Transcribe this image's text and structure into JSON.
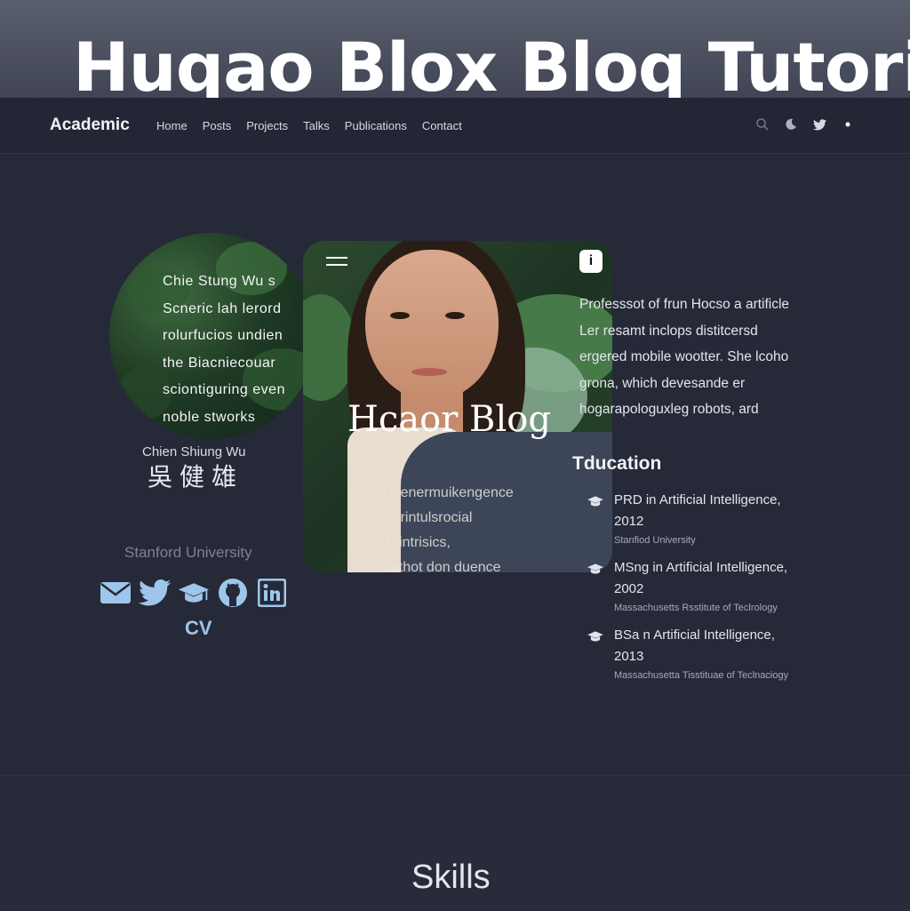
{
  "banner": {
    "title": "Huqao Blox Bloq Tutoril"
  },
  "nav": {
    "brand": "Academic",
    "links": [
      "Home",
      "Posts",
      "Projects",
      "Talks",
      "Publications",
      "Contact"
    ],
    "icons": [
      "search-icon",
      "moon-icon",
      "twitter-icon",
      "dot-icon"
    ]
  },
  "profile": {
    "circle_lines": [
      "Chie Stung Wu s",
      "Scneric lah lerord",
      "rolurfucios undien",
      "the Biacniecouar",
      "sciontiguring even",
      "noble stworks"
    ],
    "name_en": "Chien Shiung Wu",
    "name_cn": "吳健雄",
    "organization": "Stanford University",
    "social": [
      "envelope-icon",
      "twitter-icon",
      "graduation-cap-icon",
      "github-icon",
      "linkedin-icon"
    ],
    "cv_label": "CV"
  },
  "card": {
    "title": "Hcaor Blog",
    "lines": [
      "Phenermuikengence",
      "Serintulsrocial",
      "Tuintrisics,",
      "bathot don duence"
    ]
  },
  "bio": {
    "lines": [
      "Professsot of frun Hocso a artificle",
      "Ler resamt inclops distitcersd",
      "ergered mobile wootter. She lcoho",
      "grona, which devesande er",
      "hogarapologuxleg robots, ard"
    ]
  },
  "education": {
    "title": "Tducation",
    "items": [
      {
        "degree": "PRD in Artificial Intelligence,",
        "year": "2012",
        "institution": "Stanfiod University"
      },
      {
        "degree": "MSng in Artificial Intelligence,",
        "year": "2002",
        "institution": "Massachusetts Rsstitute of Teclrology"
      },
      {
        "degree": "BSa n Artificial Intelligence,",
        "year": "2013",
        "institution": "Massachusetta Tisstituae of Teclnaciogy"
      }
    ]
  },
  "skills": {
    "title": "Skills"
  },
  "colors": {
    "background": "#262938",
    "navbar": "#232735",
    "accent": "#9ec6ea"
  }
}
